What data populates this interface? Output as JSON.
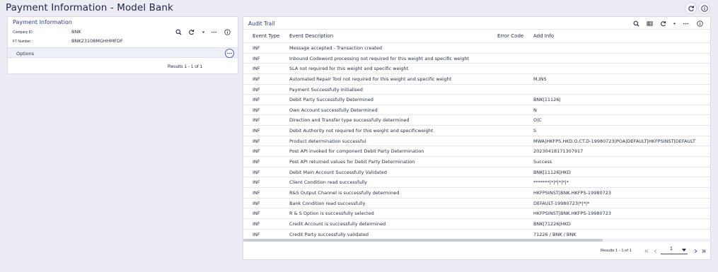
{
  "app": {
    "title": "Payment Information - Model Bank"
  },
  "payment_panel": {
    "title": "Payment Information",
    "fields": [
      {
        "label": "Company ID :",
        "value": "BNK"
      },
      {
        "label": "FT Number :",
        "value": "BNK23108MGHHMFDF"
      }
    ],
    "options_label": "Options",
    "results_text": "Results 1 - 1 of 1"
  },
  "audit_trail": {
    "title": "Audit Trail",
    "columns": {
      "event_type": "Event Type",
      "event_description": "Event Description",
      "error_code": "Error Code",
      "add_info": "Add Info"
    },
    "rows": [
      {
        "type": "INF",
        "description": "Message accepted - Transaction created",
        "error_code": "",
        "add_info": ""
      },
      {
        "type": "INF",
        "description": "Inbound Codeword processing not required for this weight and specific weight",
        "error_code": "",
        "add_info": ""
      },
      {
        "type": "INF",
        "description": "SLA not required for this weight and specific weight",
        "error_code": "",
        "add_info": ""
      },
      {
        "type": "INF",
        "description": "Automated Repair Tool not required for this weight and specific weight",
        "error_code": "",
        "add_info": "M,INS"
      },
      {
        "type": "INF",
        "description": "Payment Successfully Initialised",
        "error_code": "",
        "add_info": ""
      },
      {
        "type": "INF",
        "description": "Debit Party Successfully Determined",
        "error_code": "",
        "add_info": "BNK|11126|"
      },
      {
        "type": "INF",
        "description": "Own Account successfully Determined",
        "error_code": "",
        "add_info": "N"
      },
      {
        "type": "INF",
        "description": "Direction and Transfer type successfully determined",
        "error_code": "",
        "add_info": "O|C"
      },
      {
        "type": "INF",
        "description": "Debit Authority not required for this weight and specificweight",
        "error_code": "",
        "add_info": "S"
      },
      {
        "type": "INF",
        "description": "Product determination successful",
        "error_code": "",
        "add_info": "MWA|HKFPS.HKD.O.CT.D-19980723|POA|DEFAULT|HKFPSINST|DEFAULT"
      },
      {
        "type": "INF",
        "description": "Post API invoked for component Debit Party Determination",
        "error_code": "",
        "add_info": "20230418171307917"
      },
      {
        "type": "INF",
        "description": "Post API returned values for Debit Party Determination",
        "error_code": "",
        "add_info": "Success"
      },
      {
        "type": "INF",
        "description": "Debit Main Account Successfully Validated",
        "error_code": "",
        "add_info": "BNK|11126|HKD"
      },
      {
        "type": "INF",
        "description": "Client Condition read successfully",
        "error_code": "",
        "add_info": "*******|*|*|*|*|*"
      },
      {
        "type": "INF",
        "description": "R&S Output Channel is successfully determined",
        "error_code": "",
        "add_info": "HKFPSINST|BNK.HKFPS-19980723"
      },
      {
        "type": "INF",
        "description": "Bank Condition read successfully",
        "error_code": "",
        "add_info": "DEFAULT-19980723|*|*|*"
      },
      {
        "type": "INF",
        "description": "R & S Option is successfully selected",
        "error_code": "",
        "add_info": "HKFPSINST|BNK.HKFPS-19980723"
      },
      {
        "type": "INF",
        "description": "Credit Account is successfully determined",
        "error_code": "",
        "add_info": "BNK|71226|HKD"
      },
      {
        "type": "INF",
        "description": "Credit Party successfully validated",
        "error_code": "",
        "add_info": "71226 / BNK / BNK"
      }
    ],
    "pager": {
      "results_text": "Results 1 - 1 of 1",
      "page": "1"
    }
  },
  "theme": {
    "accent": "#2d3a8c",
    "background": "#ecedf4",
    "panel": "#ffffff"
  }
}
